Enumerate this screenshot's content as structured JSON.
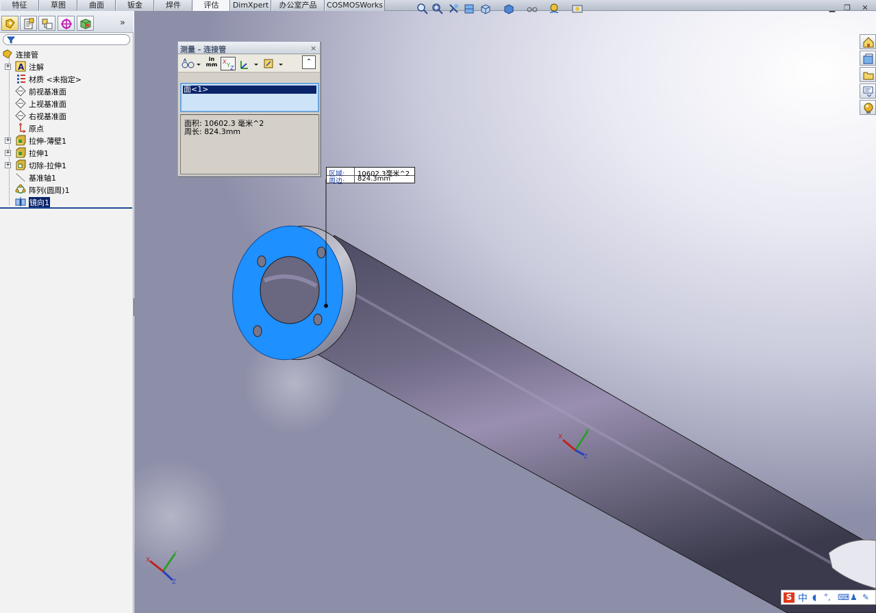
{
  "tabs": [
    {
      "label": "特征",
      "active": false
    },
    {
      "label": "草图",
      "active": false
    },
    {
      "label": "曲面",
      "active": false
    },
    {
      "label": "钣金",
      "active": false
    },
    {
      "label": "焊件",
      "active": false
    },
    {
      "label": "评估",
      "active": true
    },
    {
      "label": "DimXpert",
      "active": false
    },
    {
      "label": "办公室产品",
      "active": false
    },
    {
      "label": "COSMOSWorks",
      "active": false
    }
  ],
  "panel": {
    "more": "»",
    "tabs": [
      "feature-manager-icon",
      "property-manager-icon",
      "configuration-manager-icon",
      "dimxpert-manager-icon",
      "display-manager-icon"
    ]
  },
  "tree": {
    "root": "连接管",
    "items": [
      {
        "label": "注解",
        "icon": "annotation-icon",
        "expandable": true
      },
      {
        "label": "材质 <未指定>",
        "icon": "material-icon",
        "expandable": false
      },
      {
        "label": "前视基准面",
        "icon": "plane-icon",
        "expandable": false
      },
      {
        "label": "上视基准面",
        "icon": "plane-icon",
        "expandable": false
      },
      {
        "label": "右视基准面",
        "icon": "plane-icon",
        "expandable": false
      },
      {
        "label": "原点",
        "icon": "origin-icon",
        "expandable": false
      },
      {
        "label": "拉伸-薄壁1",
        "icon": "extrude-icon",
        "expandable": true
      },
      {
        "label": "拉伸1",
        "icon": "extrude-icon",
        "expandable": true
      },
      {
        "label": "切除-拉伸1",
        "icon": "cut-extrude-icon",
        "expandable": true
      },
      {
        "label": "基准轴1",
        "icon": "axis-icon",
        "expandable": false
      },
      {
        "label": "阵列(圆周)1",
        "icon": "circular-pattern-icon",
        "expandable": false
      },
      {
        "label": "镜向1",
        "icon": "mirror-icon",
        "expandable": false,
        "selected": true
      }
    ]
  },
  "measure": {
    "title": "测量 - 连接管",
    "close": "×",
    "units_label_top": "in",
    "units_label_bottom": "mm",
    "collapse": "⌃",
    "selection": "面<1>",
    "results": [
      "面积: 10602.3 毫米^2",
      "周长: 824.3mm"
    ]
  },
  "callout": {
    "rows": [
      {
        "key": "区域:",
        "value": "10602.3毫米^2"
      },
      {
        "key": "周边:",
        "value": "824.3mm"
      }
    ]
  },
  "triad": {
    "x": "X",
    "y": "Y",
    "z": "Z"
  },
  "ime": {
    "logo": "S",
    "lang": "中"
  },
  "colors": {
    "face_selected": "#1e90ff",
    "part_body": "#6e6a82",
    "selection_bg": "#0a246a"
  }
}
